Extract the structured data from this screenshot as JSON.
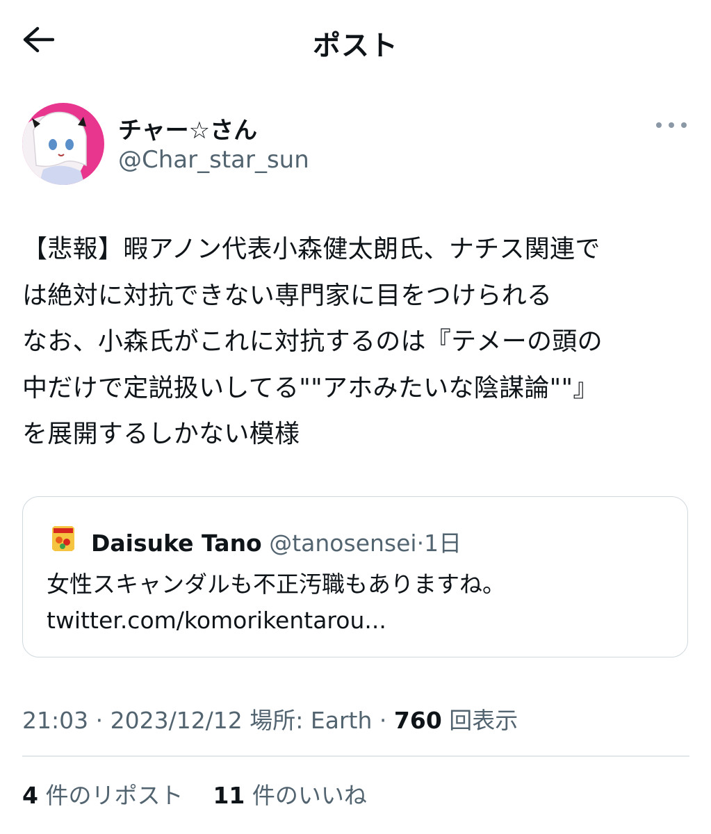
{
  "header": {
    "title": "ポスト",
    "back_icon": "arrow-left-icon"
  },
  "author": {
    "display_name": "チャー☆さん",
    "handle": "@Char_star_sun",
    "avatar_accent": "#e8368f",
    "more_icon": "more-horizontal-icon"
  },
  "post": {
    "lines": [
      "【悲報】暇アノン代表小森健太朗氏、ナチス関連で",
      "は絶対に対抗できない専門家に目をつけられる",
      "なお、小森氏がこれに対抗するのは『テメーの頭の",
      "中だけで定説扱いしてる\"\"アホみたいな陰謀論\"\"』",
      "を展開するしかない模様"
    ]
  },
  "quote": {
    "name": "Daisuke Tano",
    "handle": "@tanosensei",
    "separator": "·",
    "time": "1日",
    "text_line1": "女性スキャンダルも不正汚職もありますね。",
    "text_line2": "twitter.com/komorikentarou..."
  },
  "meta": {
    "time": "21:03",
    "dot1": " · ",
    "date": "2023/12/12",
    "location_label": "場所: Earth",
    "dot2": " · ",
    "views_count": "760",
    "views_label": "回表示"
  },
  "stats": {
    "reposts_count": "4",
    "reposts_label": "件のリポスト",
    "likes_count": "11",
    "likes_label": "件のいいね"
  },
  "colors": {
    "text_primary": "#0f1419",
    "text_secondary": "#536471",
    "border": "#cfd9de"
  }
}
